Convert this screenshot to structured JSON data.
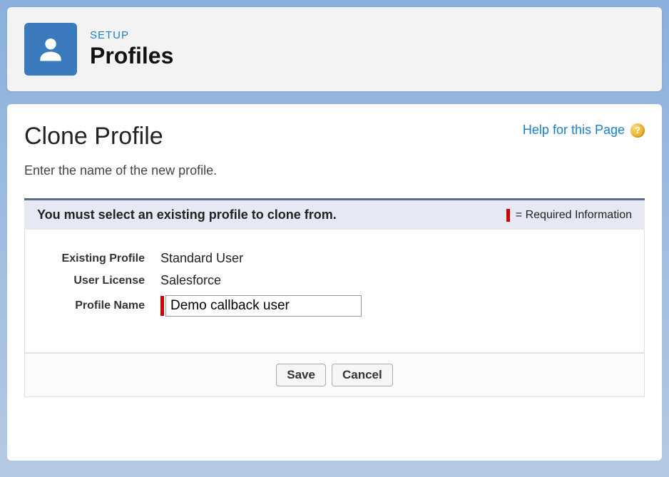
{
  "header": {
    "setup_label": "SETUP",
    "title": "Profiles"
  },
  "page": {
    "title": "Clone Profile",
    "help_link": "Help for this Page",
    "subtext": "Enter the name of the new profile."
  },
  "info_bar": {
    "message": "You must select an existing profile to clone from.",
    "required_label": "= Required Information"
  },
  "form": {
    "existing_profile_label": "Existing Profile",
    "existing_profile_value": "Standard User",
    "user_license_label": "User License",
    "user_license_value": "Salesforce",
    "profile_name_label": "Profile Name",
    "profile_name_value": "Demo callback user"
  },
  "buttons": {
    "save": "Save",
    "cancel": "Cancel"
  }
}
